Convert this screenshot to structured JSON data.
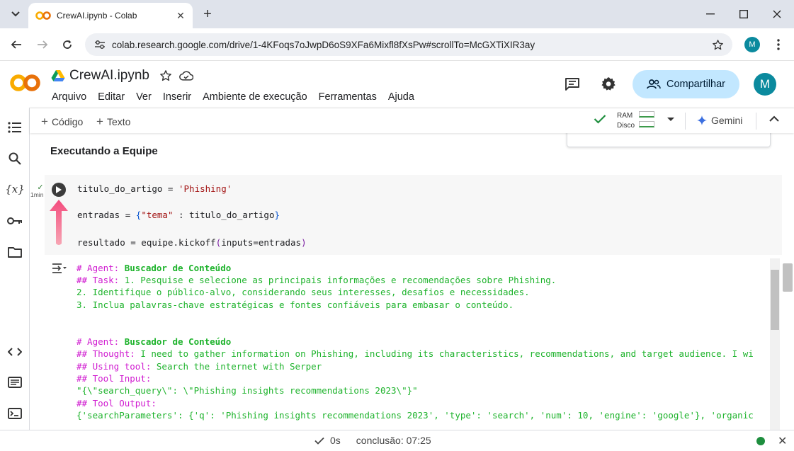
{
  "browser": {
    "tab_title": "CrewAI.ipynb - Colab",
    "url": "colab.research.google.com/drive/1-4KFoqs7oJwpD6oS9XFa6Mixfl8fXsPw#scrollTo=McGXTiXIR3ay",
    "profile_initial": "M"
  },
  "colab": {
    "notebook_title": "CrewAI.ipynb",
    "menu": [
      "Arquivo",
      "Editar",
      "Ver",
      "Inserir",
      "Ambiente de execução",
      "Ferramentas",
      "Ajuda"
    ],
    "share_label": "Compartilhar",
    "avatar_initial": "M",
    "accent": "#c2e7ff"
  },
  "toolbar": {
    "add_code": "Código",
    "add_text": "Texto",
    "ram_label": "RAM",
    "disk_label": "Disco",
    "gemini_label": "Gemini"
  },
  "section_title": "Executando a Equipe",
  "cell": {
    "exec_time": "1min",
    "line1_prefix": "titulo_do_artigo = ",
    "line1_str": "'Phishing'",
    "line2_prefix": "entradas = ",
    "line2_open": "{",
    "line2_key": "\"tema\"",
    "line2_mid": " : titulo_do_artigo",
    "line2_close": "}",
    "line3_prefix": "resultado = equipe.kickoff",
    "line3_open": "(",
    "line3_args": "inputs=entradas",
    "line3_close": ")"
  },
  "output": {
    "block1": {
      "agent_label": "# Agent: ",
      "agent_name": "Buscador de Conteúdo",
      "task_label": "## Task: ",
      "task_text": "1. Pesquise e selecione as principais informações e recomendações sobre Phishing.",
      "line2": "2. Identifique o público-alvo, considerando seus interesses, desafios e necessidades.",
      "line3": "3. Inclua palavras-chave estratégicas e fontes confiáveis para embasar o conteúdo."
    },
    "block2": {
      "agent_label": "# Agent: ",
      "agent_name": "Buscador de Conteúdo",
      "thought_label": "## Thought: ",
      "thought_text": "I need to gather information on Phishing, including its characteristics, recommendations, and target audience. I wi",
      "tool_label": "## Using tool: ",
      "tool_text": "Search the internet with Serper",
      "input_label": "## Tool Input: ",
      "input_text": "\"{\\\"search_query\\\": \\\"Phishing insights recommendations 2023\\\"}\"",
      "output_label": "## Tool Output: ",
      "output_text": "{'searchParameters': {'q': 'Phishing insights recommendations 2023', 'type': 'search', 'num': 10, 'engine': 'google'}, 'organic"
    }
  },
  "status": {
    "elapsed": "0s",
    "completion": "conclusão: 07:25"
  }
}
